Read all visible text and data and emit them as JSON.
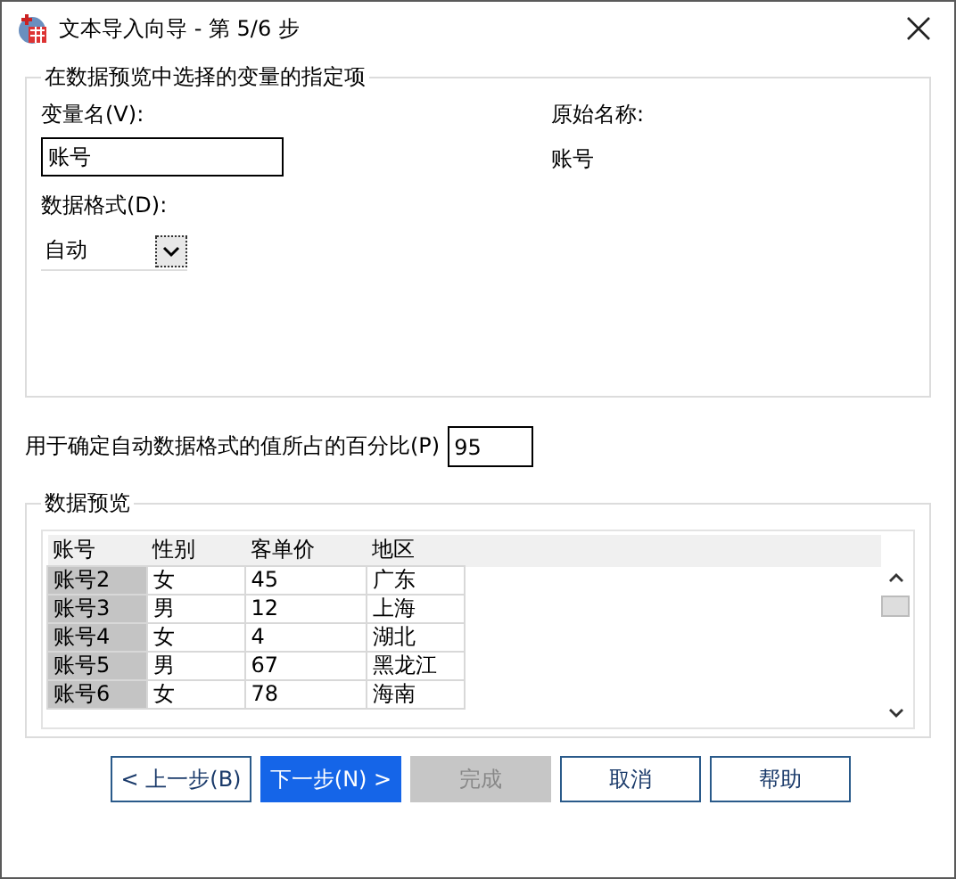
{
  "window": {
    "title": "文本导入向导 - 第 5/6 步"
  },
  "spec_group": {
    "title": "在数据预览中选择的变量的指定项",
    "variable_name_label": "变量名(V):",
    "variable_name_value": "账号",
    "original_name_label": "原始名称:",
    "original_name_value": "账号",
    "format_label": "数据格式(D):",
    "format_value": "自动"
  },
  "percent": {
    "label": "用于确定自动数据格式的值所占的百分比(P)",
    "value": "95"
  },
  "preview": {
    "title": "数据预览",
    "columns": [
      {
        "label": "账号",
        "selected": true
      },
      {
        "label": "性别",
        "selected": false
      },
      {
        "label": "客单价",
        "selected": false
      },
      {
        "label": "地区",
        "selected": false
      }
    ],
    "rows": [
      [
        "账号2",
        "女",
        "45",
        "广东"
      ],
      [
        "账号3",
        "男",
        "12",
        "上海"
      ],
      [
        "账号4",
        "女",
        "4",
        "湖北"
      ],
      [
        "账号5",
        "男",
        "67",
        "黑龙江"
      ],
      [
        "账号6",
        "女",
        "78",
        "海南"
      ]
    ]
  },
  "buttons": [
    {
      "label": "< 上一步(B)",
      "kind": "normal",
      "disabled": false
    },
    {
      "label": "下一步(N) >",
      "kind": "primary",
      "disabled": false
    },
    {
      "label": "完成",
      "kind": "normal",
      "disabled": true
    },
    {
      "label": "取消",
      "kind": "normal",
      "disabled": false
    },
    {
      "label": "帮助",
      "kind": "normal",
      "disabled": false
    }
  ]
}
